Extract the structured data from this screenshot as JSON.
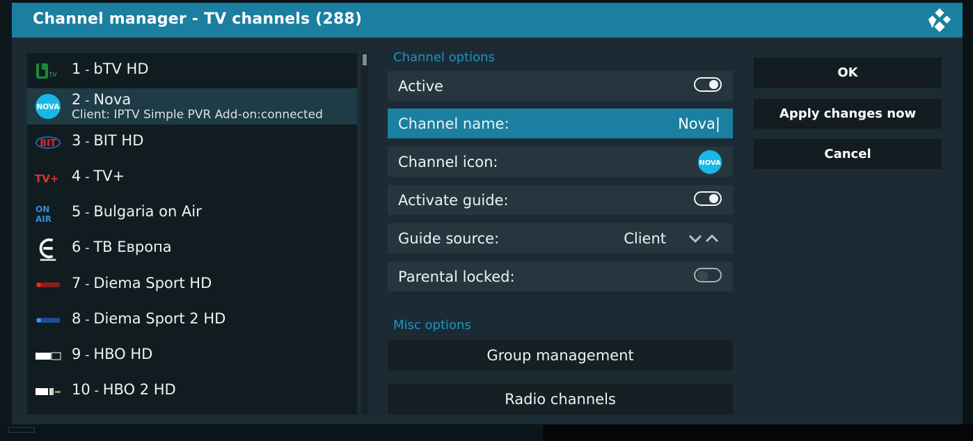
{
  "dialog": {
    "title": "Channel manager - TV channels (288)"
  },
  "channels": [
    {
      "num": "1",
      "name": "bTV HD",
      "logo": "btv-logo"
    },
    {
      "num": "2",
      "name": "Nova",
      "logo": "nova-logo",
      "sub": "Client: IPTV Simple PVR Add-on:connected"
    },
    {
      "num": "3",
      "name": "BIT HD",
      "logo": "bit-logo"
    },
    {
      "num": "4",
      "name": "TV+",
      "logo": "tvplus-logo"
    },
    {
      "num": "5",
      "name": "Bulgaria on Air",
      "logo": "on-air-logo"
    },
    {
      "num": "6",
      "name": "ТВ Европа",
      "logo": "tv-evropa-logo"
    },
    {
      "num": "7",
      "name": "Diema Sport HD",
      "logo": "diema-sport-logo"
    },
    {
      "num": "8",
      "name": "Diema Sport 2 HD",
      "logo": "diema-sport-2-logo"
    },
    {
      "num": "9",
      "name": "HBO HD",
      "logo": "hbo-logo"
    },
    {
      "num": "10",
      "name": "HBO 2 HD",
      "logo": "hbo-2-logo"
    }
  ],
  "channel_options": {
    "heading": "Channel options",
    "active_label": "Active",
    "active_on": true,
    "name_label": "Channel name:",
    "name_value": "Nova|",
    "icon_label": "Channel icon:",
    "guide_label": "Activate guide:",
    "guide_on": true,
    "source_label": "Guide source:",
    "source_value": "Client",
    "parental_label": "Parental locked:",
    "parental_on": false
  },
  "misc_options": {
    "heading": "Misc options",
    "group_management": "Group management",
    "radio_channels": "Radio channels"
  },
  "buttons": {
    "ok": "OK",
    "apply": "Apply changes now",
    "cancel": "Cancel"
  },
  "colors": {
    "titlebar": "#1a7fa0",
    "focus": "#1a7fa0",
    "dialog_bg": "#1c2b33",
    "section_heading": "#1a95c2"
  }
}
